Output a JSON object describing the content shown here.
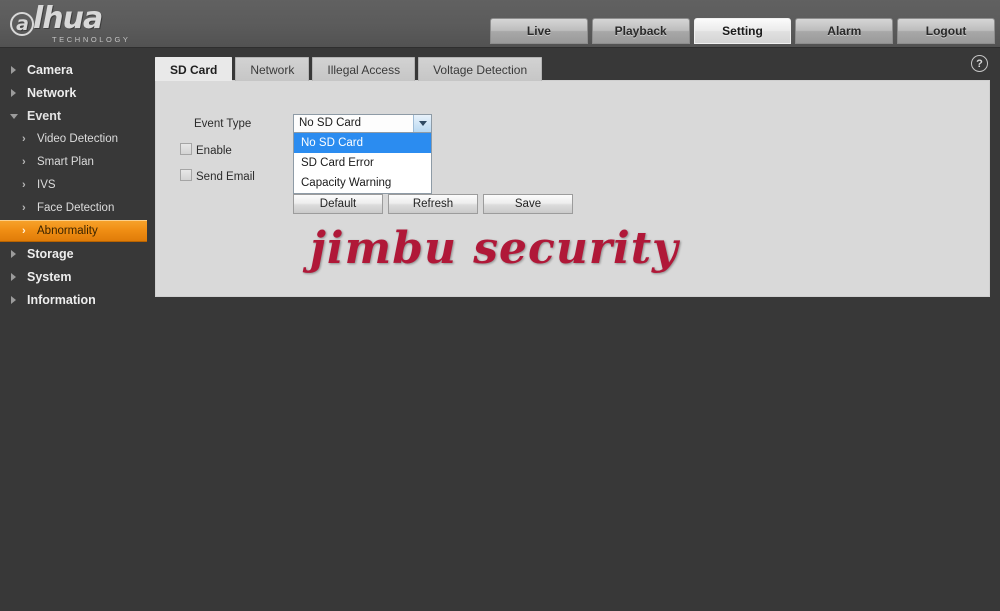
{
  "header": {
    "logo": {
      "brand_initial": "a",
      "brand_rest": "lhua",
      "tagline": "TECHNOLOGY"
    },
    "nav": [
      {
        "label": "Live",
        "active": false
      },
      {
        "label": "Playback",
        "active": false
      },
      {
        "label": "Setting",
        "active": true
      },
      {
        "label": "Alarm",
        "active": false
      },
      {
        "label": "Logout",
        "active": false
      }
    ]
  },
  "sidebar": {
    "items": [
      {
        "label": "Camera",
        "level": "top",
        "state": "collapsed"
      },
      {
        "label": "Network",
        "level": "top",
        "state": "collapsed"
      },
      {
        "label": "Event",
        "level": "top",
        "state": "expanded"
      },
      {
        "label": "Video Detection",
        "level": "sub",
        "selected": false
      },
      {
        "label": "Smart Plan",
        "level": "sub",
        "selected": false
      },
      {
        "label": "IVS",
        "level": "sub",
        "selected": false
      },
      {
        "label": "Face Detection",
        "level": "sub",
        "selected": false
      },
      {
        "label": "Abnormality",
        "level": "sub",
        "selected": true
      },
      {
        "label": "Storage",
        "level": "top",
        "state": "collapsed"
      },
      {
        "label": "System",
        "level": "top",
        "state": "collapsed"
      },
      {
        "label": "Information",
        "level": "top",
        "state": "collapsed"
      }
    ]
  },
  "content": {
    "help_icon": "?",
    "tabs": [
      {
        "label": "SD Card",
        "active": true
      },
      {
        "label": "Network",
        "active": false
      },
      {
        "label": "Illegal Access",
        "active": false
      },
      {
        "label": "Voltage Detection",
        "active": false
      }
    ],
    "form": {
      "event_type_label": "Event Type",
      "event_type_value": "No SD Card",
      "event_type_options": [
        {
          "label": "No SD Card",
          "highlighted": true
        },
        {
          "label": "SD Card Error",
          "highlighted": false
        },
        {
          "label": "Capacity Warning",
          "highlighted": false
        }
      ],
      "enable_label": "Enable",
      "enable_checked": false,
      "send_email_label": "Send Email",
      "send_email_checked": false
    },
    "buttons": [
      {
        "label": "Default"
      },
      {
        "label": "Refresh"
      },
      {
        "label": "Save"
      }
    ]
  },
  "watermark": {
    "text": "jimbu security",
    "color": "#b01838"
  },
  "theme": {
    "header_gray": "#5b5b5b",
    "body_dark": "#383838",
    "panel_gray": "#d9d9d9",
    "tab_active": "#e9e9e9",
    "accent_orange": "#f08e14",
    "select_highlight": "#2b8cf0"
  }
}
